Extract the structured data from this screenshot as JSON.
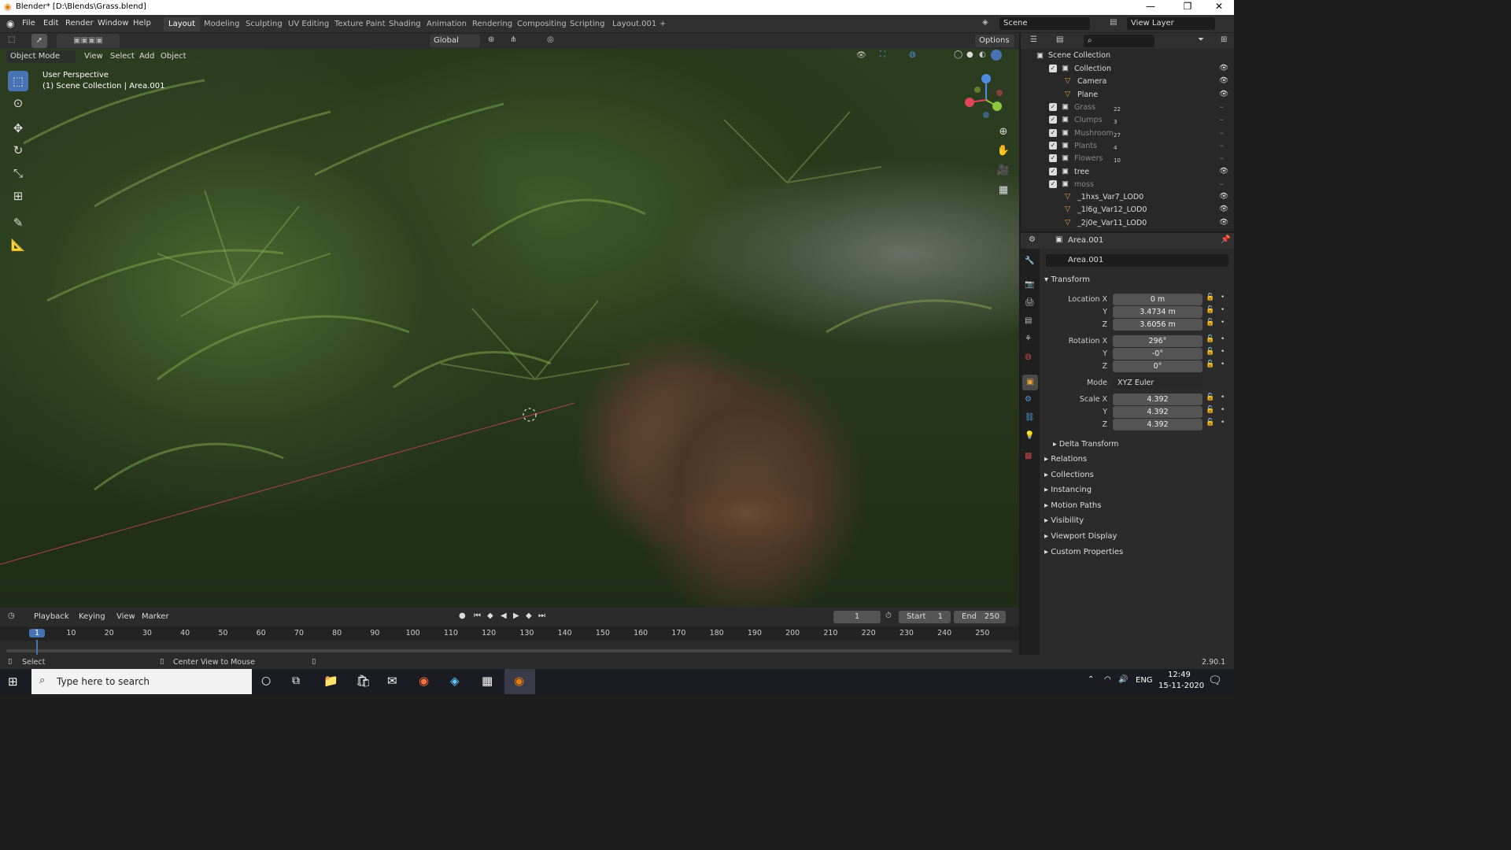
{
  "window": {
    "title": "Blender* [D:\\Blends\\Grass.blend]",
    "minimize": "—",
    "maximize": "❐",
    "close": "✕"
  },
  "menu": [
    "File",
    "Edit",
    "Render",
    "Window",
    "Help"
  ],
  "workspaces": [
    "Layout",
    "Modeling",
    "Sculpting",
    "UV Editing",
    "Texture Paint",
    "Shading",
    "Animation",
    "Rendering",
    "Compositing",
    "Scripting",
    "Layout.001",
    "+"
  ],
  "scene": {
    "label": "Scene",
    "view_layer": "View Layer"
  },
  "viewport": {
    "mode": "Object Mode",
    "menus": [
      "View",
      "Select",
      "Add",
      "Object"
    ],
    "orientation": "Global",
    "options": "Options",
    "overlay_title": "User Perspective",
    "overlay_sub": "(1) Scene Collection | Area.001"
  },
  "outliner": {
    "root": "Scene Collection",
    "rows": [
      {
        "name": "Collection",
        "badge": ""
      },
      {
        "name": "Camera",
        "badge": ""
      },
      {
        "name": "Plane",
        "badge": ""
      },
      {
        "name": "Grass",
        "badge": "22"
      },
      {
        "name": "Clumps",
        "badge": "3"
      },
      {
        "name": "Mushroom",
        "badge": "27"
      },
      {
        "name": "Plants",
        "badge": "4"
      },
      {
        "name": "Flowers",
        "badge": "10"
      },
      {
        "name": "tree",
        "badge": ""
      },
      {
        "name": "moss",
        "badge": ""
      },
      {
        "name": "_1hxs_Var7_LOD0",
        "badge": ""
      },
      {
        "name": "_1l6g_Var12_LOD0",
        "badge": ""
      },
      {
        "name": "_2j0e_Var11_LOD0",
        "badge": ""
      }
    ]
  },
  "properties": {
    "object": "Area.001",
    "object_field": "Area.001",
    "transform": "Transform",
    "location_label": "Location X",
    "location": [
      "0 m",
      "3.4734 m",
      "3.6056 m"
    ],
    "rotation_label": "Rotation X",
    "rotation": [
      "296°",
      "-0°",
      "0°"
    ],
    "mode_label": "Mode",
    "mode": "XYZ Euler",
    "scale_label": "Scale X",
    "scale": [
      "4.392",
      "4.392",
      "4.392"
    ],
    "axis_y": "Y",
    "axis_z": "Z",
    "delta": "Delta Transform",
    "sections": [
      "Relations",
      "Collections",
      "Instancing",
      "Motion Paths",
      "Visibility",
      "Viewport Display",
      "Custom Properties"
    ]
  },
  "timeline": {
    "menus": [
      "Playback",
      "Keying",
      "View",
      "Marker"
    ],
    "current": "1",
    "start_label": "Start",
    "start": "1",
    "end_label": "End",
    "end": "250",
    "ticks": [
      "1",
      "10",
      "20",
      "30",
      "40",
      "50",
      "60",
      "70",
      "80",
      "90",
      "100",
      "110",
      "120",
      "130",
      "140",
      "150",
      "160",
      "170",
      "180",
      "190",
      "200",
      "210",
      "220",
      "230",
      "240",
      "250"
    ]
  },
  "status": {
    "left": "Select",
    "mid": "Center View to Mouse",
    "version": "2.90.1"
  },
  "taskbar": {
    "search": "Type here to search",
    "lang": "ENG",
    "time": "12:49",
    "date": "15-11-2020"
  }
}
